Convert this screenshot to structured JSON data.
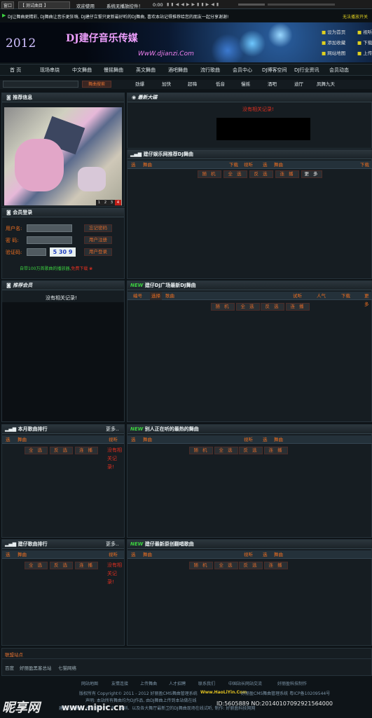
{
  "player": {
    "btn1": "窗口",
    "btn2": "【 测试曲目 】",
    "welcome": "欢迎使用",
    "sys": "系统无播放控件！",
    "time": "0:00",
    "right": "无法播放开关"
  },
  "marquee": "DJ让舞曲更精彩, DJ舞曲让音乐更狂嗨, DJ建仔立誓只更新最好听的DJ舞曲, 喜欢本站记得推荐给您的朋友一起分享谢谢!",
  "banner": {
    "year": "2012",
    "title": "DJ建仔音乐传媒",
    "url": "WwW.djianzi.Com",
    "links": [
      "设为首页",
      "添加收藏",
      "网站地图"
    ],
    "links2": [
      "视听",
      "下载",
      "上传"
    ]
  },
  "nav": [
    "首 页",
    "现场串烧",
    "中文舞曲",
    "慢摇舞曲",
    "英文舞曲",
    "酒吧舞曲",
    "流行歌曲",
    "会员中心",
    "DJ博客空间",
    "DJ行业资讯",
    "会员动态"
  ],
  "search": {
    "button": "舞曲搜索"
  },
  "tabs": [
    "劲爆",
    "加快",
    "超嗨",
    "低音",
    "慢摇",
    "酒吧",
    "迪厅",
    "凤舞九天"
  ],
  "recommend": {
    "title": "推荐信息",
    "pages": [
      "1",
      "2",
      "3",
      "4"
    ]
  },
  "login": {
    "title": "会员登录",
    "user": "用户名:",
    "pass": "密 码:",
    "code": "验证码:",
    "captcha": "5 30 9",
    "forgot": "忘记密码",
    "register": "用户注册",
    "login": "用户登录",
    "promo": "自带100万首歌曲的播放器,",
    "promo_red": "免费下载"
  },
  "latest": {
    "title": "最新大碟",
    "empty": "没有相关记录!"
  },
  "recDJ": {
    "title": "建仔娱乐网推荐DJ舞曲",
    "cols": [
      "选",
      "舞曲",
      "下载",
      "视听",
      "选",
      "舞曲",
      "下载"
    ],
    "buttons": [
      "随 机",
      "全 选",
      "反 选",
      "连 播",
      "更 多"
    ]
  },
  "members": {
    "title": "推荐会员",
    "empty": "没有相关记录!"
  },
  "square": {
    "badge": "NEW",
    "title": "建仔DJ广场最新DJ舞曲",
    "cols": [
      "编号",
      "选择",
      "歌曲",
      "试听",
      "人气",
      "下载",
      "更多"
    ],
    "buttons": [
      "随 机",
      "全 选",
      "反 选",
      "连 播"
    ]
  },
  "monthly": {
    "title": "本月歌曲排行",
    "more": "更多..",
    "cols": [
      "选",
      "舞曲",
      "视听"
    ],
    "buttons": [
      "全 选",
      "反 选",
      "连 播"
    ],
    "empty": "没有相关记录!"
  },
  "hot": {
    "badge": "NEW",
    "title": "别人正在听的最热的舞曲",
    "cols": [
      "选",
      "舞曲",
      "视听",
      "选",
      "舞曲"
    ],
    "buttons": [
      "随 机",
      "全 选",
      "反 选",
      "连 播"
    ]
  },
  "ranking": {
    "title": "建仔歌曲排行",
    "more": "更多..",
    "cols": [
      "选",
      "舞曲",
      "视听"
    ],
    "buttons": [
      "全 选",
      "反 选",
      "连 播"
    ],
    "empty": "没有相关记录!"
  },
  "original": {
    "badge": "NEW",
    "title": "建仔最新原创翻唱歌曲",
    "cols": [
      "选",
      "舞曲",
      "视听",
      "选",
      "舞曲"
    ],
    "buttons": [
      "随 机",
      "全 选",
      "反 选",
      "连 播"
    ]
  },
  "friends": {
    "title": "联盟站点",
    "items": [
      "百度",
      "好丽盈黑客总站",
      "七猫网络"
    ]
  },
  "footer": {
    "links": [
      "网站地图",
      "友情连接",
      "上传舞曲",
      "人才招聘",
      "联系我们",
      "中国站长网站交流",
      "好丽盈科技制作"
    ],
    "copy": "版权所有 Copyright© 2011 - 2012 好丽盈CMS舞曲管理系统",
    "copy_url": "Www.HaoLiYin.Com",
    "copy2": "好丽盈CMS舞曲管理系统 粤ICP备10209544号",
    "line2": "声明: 本站所有舞曲均为DJ作品, 由DJ舞曲上传到本站做在线",
    "line3": "建仔DJ舞曲网 主要服务于广东、深圳、以及各大舞厅最新卫的DJ舞曲现场在线试听, 制作: 好丽盈科技网网",
    "wm_logo": "昵享网",
    "wm_url": "www.nipic.cn",
    "wm_id": "ID:5605889 NO:20140107092921564000"
  }
}
